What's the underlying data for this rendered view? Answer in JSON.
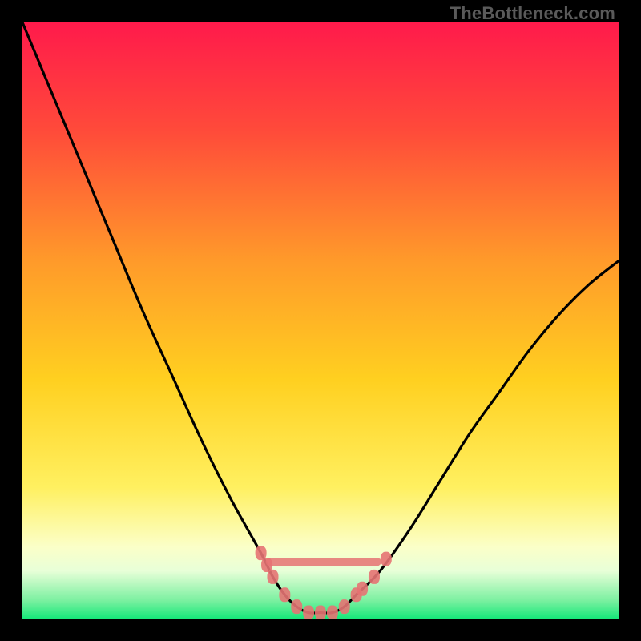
{
  "watermark": "TheBottleneck.com",
  "colors": {
    "frame": "#000000",
    "gradient_top": "#ff1a4b",
    "gradient_mid1": "#ff7a2a",
    "gradient_mid2": "#ffd020",
    "gradient_mid3": "#fff27a",
    "gradient_low_band": "#f7ffd0",
    "gradient_bottom": "#17e87a",
    "curve": "#000000",
    "markers": "#e57373"
  },
  "chart_data": {
    "type": "line",
    "title": "",
    "xlabel": "",
    "ylabel": "",
    "xlim": [
      0,
      100
    ],
    "ylim": [
      0,
      100
    ],
    "x": [
      0,
      5,
      10,
      15,
      20,
      25,
      30,
      35,
      40,
      42,
      44,
      46,
      48,
      50,
      52,
      54,
      56,
      60,
      65,
      70,
      75,
      80,
      85,
      90,
      95,
      100
    ],
    "values": [
      100,
      88,
      76,
      64,
      52,
      41,
      30,
      20,
      11,
      7,
      4,
      2,
      1,
      1,
      1,
      2,
      4,
      8,
      15,
      23,
      31,
      38,
      45,
      51,
      56,
      60
    ],
    "annotations": [
      {
        "text": "TheBottleneck.com",
        "position": "top-right"
      }
    ],
    "markers": [
      {
        "x": 40,
        "y": 11
      },
      {
        "x": 41,
        "y": 9
      },
      {
        "x": 42,
        "y": 7
      },
      {
        "x": 44,
        "y": 4
      },
      {
        "x": 46,
        "y": 2
      },
      {
        "x": 48,
        "y": 1
      },
      {
        "x": 50,
        "y": 1
      },
      {
        "x": 52,
        "y": 1
      },
      {
        "x": 54,
        "y": 2
      },
      {
        "x": 56,
        "y": 4
      },
      {
        "x": 57,
        "y": 5
      },
      {
        "x": 59,
        "y": 7
      },
      {
        "x": 61,
        "y": 10
      }
    ]
  }
}
